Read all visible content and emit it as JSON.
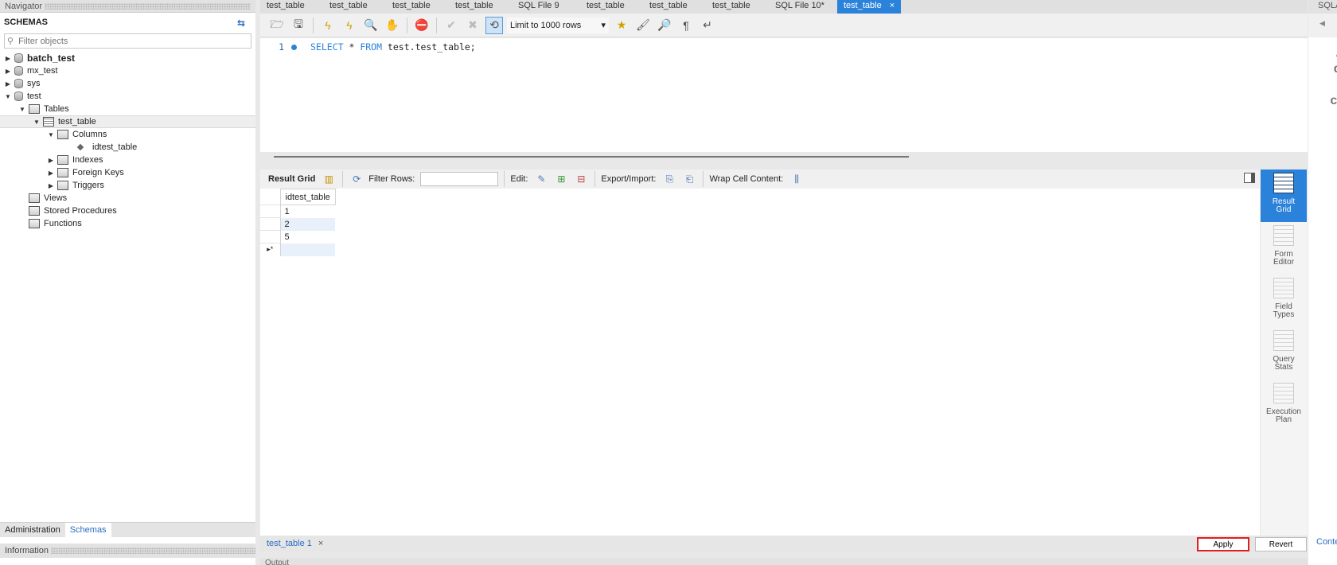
{
  "navigator": {
    "title": "Navigator",
    "schemas_header": "SCHEMAS",
    "filter_placeholder": "Filter objects",
    "tree": {
      "batch_test": "batch_test",
      "mx_test": "mx_test",
      "sys": "sys",
      "test": "test",
      "tables": "Tables",
      "test_table": "test_table",
      "columns": "Columns",
      "idtest_table": "idtest_table",
      "indexes": "Indexes",
      "foreign_keys": "Foreign Keys",
      "triggers": "Triggers",
      "views": "Views",
      "stored_procedures": "Stored Procedures",
      "functions": "Functions"
    },
    "bottom_tabs": [
      "Administration",
      "Schemas"
    ],
    "information": "Information"
  },
  "tabs": [
    "test_table",
    "test_table",
    "test_table",
    "test_table",
    "SQL File 9",
    "test_table",
    "test_table",
    "test_table",
    "SQL File 10*",
    "test_table"
  ],
  "active_tab_close": "×",
  "toolbar": {
    "limit": "Limit to 1000 rows"
  },
  "editor": {
    "line_number": "1",
    "kw_select": "SELECT",
    "star": " * ",
    "kw_from": "FROM",
    "target": " test.test_table;"
  },
  "result_toolbar": {
    "result_grid": "Result Grid",
    "filter_rows": "Filter Rows:",
    "edit": "Edit:",
    "export_import": "Export/Import:",
    "wrap": "Wrap Cell Content:"
  },
  "grid": {
    "column": "idtest_table",
    "rows": [
      "1",
      "2",
      "5",
      ""
    ],
    "new_row_marker": "▸*"
  },
  "side_panel": [
    {
      "label1": "Result",
      "label2": "Grid"
    },
    {
      "label1": "Form",
      "label2": "Editor"
    },
    {
      "label1": "Field",
      "label2": "Types"
    },
    {
      "label1": "Query",
      "label2": "Stats"
    },
    {
      "label1": "Execution",
      "label2": "Plan"
    }
  ],
  "bottom": {
    "result_tab": "test_table 1",
    "close": "×",
    "apply": "Apply",
    "revert": "Revert",
    "output": "Output"
  },
  "right_panel": {
    "title": "SQLA",
    "text": [
      "A",
      "di",
      "r",
      "cu"
    ],
    "context": "Conte"
  },
  "colors": {
    "accent": "#2a82da",
    "highlight": "#e02020"
  }
}
